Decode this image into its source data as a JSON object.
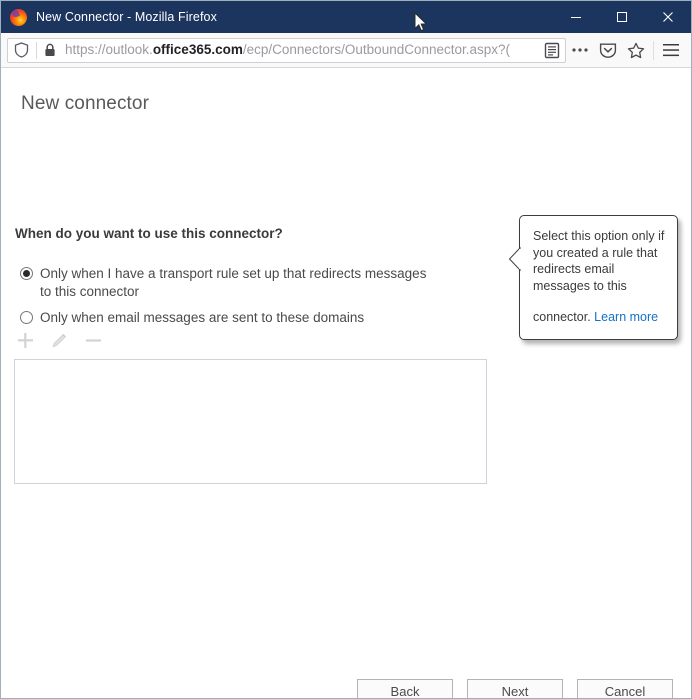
{
  "browser": {
    "window_title": "New Connector - Mozilla Firefox",
    "logo_name": "firefox-logo",
    "window_controls": {
      "minimize": "minimize",
      "maximize": "maximize",
      "close": "close"
    },
    "url": {
      "prefix": "https://outlook.",
      "domain": "office365.com",
      "suffix": "/ecp/Connectors/OutboundConnector.aspx?(",
      "full": "https://outlook.office365.com/ecp/Connectors/OutboundConnector.aspx?("
    },
    "toolbar_icons": [
      "shield-icon",
      "lock-icon",
      "reader-view-icon",
      "page-actions-ellipsis-icon",
      "pocket-icon",
      "bookmark-star-icon",
      "hamburger-menu-icon"
    ]
  },
  "page": {
    "title": "New connector",
    "question": "When do you want to use this connector?",
    "radio_options": [
      {
        "label": "Only when I have a transport rule set up that redirects messages to this connector",
        "selected": true
      },
      {
        "label": "Only when email messages are sent to these domains",
        "selected": false
      }
    ],
    "mini_toolbar": [
      {
        "name": "add-icon",
        "glyph": "+",
        "disabled": true
      },
      {
        "name": "edit-pencil-icon",
        "glyph": "✎",
        "disabled": true
      },
      {
        "name": "remove-icon",
        "glyph": "–",
        "disabled": true
      }
    ],
    "domains_list": {
      "items": [],
      "empty": true
    },
    "callout": {
      "text": "Select this option only if you created a rule that redirects email messages to this connector.",
      "link_label": "Learn more",
      "link_color": "#1471c6"
    },
    "buttons": {
      "back": "Back",
      "next": "Next",
      "cancel": "Cancel"
    }
  },
  "colors": {
    "titlebar": "#1b355e",
    "accent_link": "#1471c6",
    "border": "#9fb0bd"
  }
}
